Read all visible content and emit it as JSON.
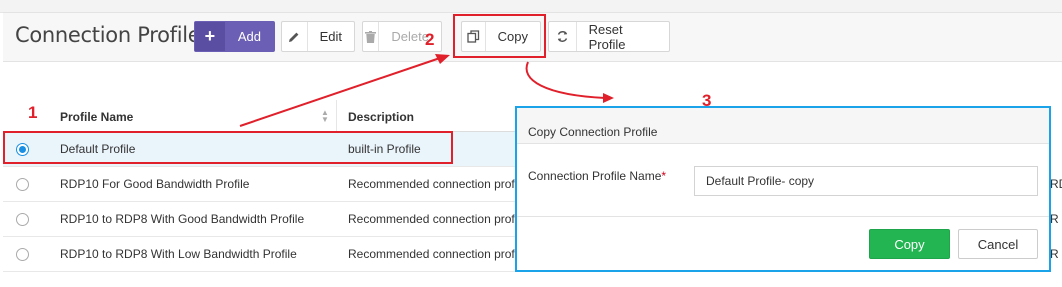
{
  "header": {
    "title": "Connection Profiles",
    "buttons": {
      "add": "Add",
      "edit": "Edit",
      "delete": "Delete",
      "copy": "Copy",
      "reset": "Reset Profile"
    },
    "icons": [
      "plus-icon",
      "pencil-icon",
      "trash-icon",
      "copy-icon",
      "reset-icon"
    ]
  },
  "annotations": {
    "step1": "1",
    "step2": "2",
    "step3": "3",
    "color": "#e0202a",
    "dialog_frame_color": "#1aa3e8"
  },
  "table": {
    "columns": [
      "Profile Name",
      "Description"
    ],
    "rows": [
      {
        "name": "Default Profile",
        "description": "built-in Profile",
        "selected": true
      },
      {
        "name": "RDP10 For Good Bandwidth Profile",
        "description": "Recommended connection profi",
        "selected": false
      },
      {
        "name": "RDP10 to RDP8 With Good Bandwidth Profile",
        "description": "Recommended connection profi",
        "selected": false
      },
      {
        "name": "RDP10 to RDP8 With Low Bandwidth Profile",
        "description": "Recommended connection profi",
        "selected": false
      }
    ]
  },
  "dialog": {
    "title": "Copy Connection Profile",
    "field_label": "Connection Profile Name",
    "required_mark": "*",
    "field_value": "Default Profile- copy",
    "copy_label": "Copy",
    "cancel_label": "Cancel",
    "copy_color": "#22b552"
  },
  "right_edge_text": [
    "RD",
    "R",
    "R"
  ]
}
